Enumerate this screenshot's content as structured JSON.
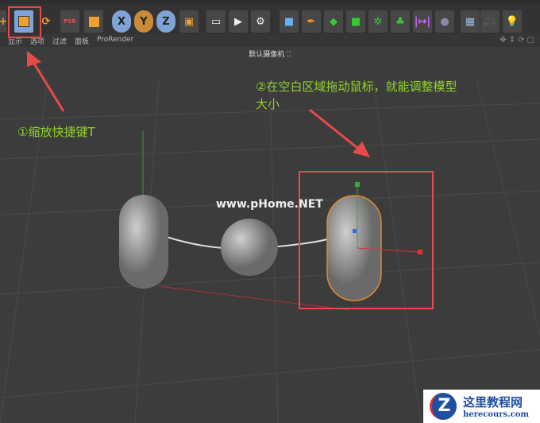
{
  "toolbar": {
    "icons": [
      "move-icon",
      "scale-icon",
      "rotate-icon",
      "psr-icon",
      "coordinate-icon",
      "x-axis-icon",
      "y-axis-icon",
      "z-axis-icon",
      "world-coordinates-icon",
      "render-view-icon",
      "render-icon",
      "render-settings-icon",
      "cube-icon",
      "pen-icon",
      "subdivision-icon",
      "extrude-icon",
      "mograph-cloner-icon",
      "array-icon",
      "symmetry-icon",
      "deformer-icon",
      "floor-icon",
      "camera-icon",
      "light-icon"
    ],
    "axis_labels": [
      "X",
      "Y",
      "Z"
    ],
    "psr_label": "PSR",
    "accent": "#f0a030",
    "selected": "#7fa3d6"
  },
  "viewport_tabs": [
    "显示",
    "选项",
    "过滤",
    "面板",
    "ProRender"
  ],
  "camera_label": "默认摄像机",
  "annotations": {
    "step1": "①缩放快捷键T",
    "step2_line1": "②在空白区域拖动鼠标，就能调整模型",
    "step2_line2": "大小",
    "color": "#8fd42a",
    "highlight": "#e84a4a"
  },
  "watermark_center": "www.pHome.NET",
  "logo": {
    "title": "这里教程网",
    "url": "herecours.com"
  }
}
